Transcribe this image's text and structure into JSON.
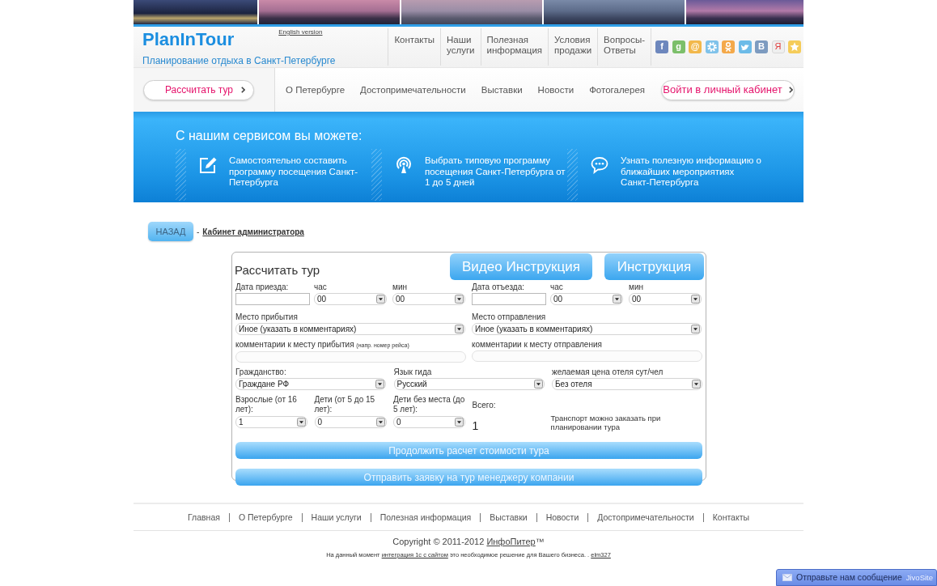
{
  "header": {
    "logo": "PlanInTour",
    "language_link": "English version",
    "tagline": "Планирование отдыха в Санкт-Петербурге",
    "top_nav": [
      "Контакты",
      "Наши услуги",
      "Полезная информация",
      "Условия продажи",
      "Вопросы-Ответы"
    ],
    "share_icons": [
      {
        "kind": "letter",
        "glyph": "f",
        "color": "#6d87bd"
      },
      {
        "kind": "letter",
        "glyph": "g",
        "color": "#7cbf6a"
      },
      {
        "kind": "letter",
        "glyph": "@",
        "color": "#f2b84b"
      },
      {
        "kind": "gear",
        "color": "#7fc2ea"
      },
      {
        "kind": "figure",
        "color": "#f4a94a"
      },
      {
        "kind": "bird",
        "color": "#6cbbe8"
      },
      {
        "kind": "letter",
        "glyph": "В",
        "color": "#7d9bc0"
      },
      {
        "kind": "red_letter",
        "glyph": "Я",
        "color": "#efefef"
      },
      {
        "kind": "star",
        "color": "#f5cc5a"
      }
    ]
  },
  "sub_nav": {
    "calc_button": "Рассчитать тур",
    "links": [
      "О Петербурге",
      "Достопримечательности",
      "Выставки",
      "Новости",
      "Фотогалерея"
    ],
    "login_button": "Войти в личный кабинет"
  },
  "banner": {
    "title": "С нашим сервисом вы можете:",
    "features": [
      {
        "kind": "edit",
        "text": "Самостоятельно составить программу посещения Санкт-Петербурга"
      },
      {
        "kind": "antenna",
        "text": "Выбрать типовую программу посещения Санкт-Петербурга от 1 до 5 дней"
      },
      {
        "kind": "chat",
        "text": "Узнать полезную информацию о ближайших мероприятиях Санкт-Петербурга"
      }
    ]
  },
  "breadcrumb": {
    "back_button": "НАЗАД",
    "separator": "-",
    "current": "Кабинет администратора"
  },
  "form": {
    "title": "Рассчитать тур",
    "buttons": [
      "Видео Инструкция",
      "Инструкция"
    ],
    "arrival": {
      "date_label": "Дата приезда:",
      "hour_label": "час",
      "hour_value": "00",
      "minute_label": "мин",
      "minute_value": "00"
    },
    "departure": {
      "date_label": "Дата отъезда:",
      "hour_label": "час",
      "hour_value": "00",
      "minute_label": "мин",
      "minute_value": "00"
    },
    "arrival_place": {
      "label": "Место прибытия",
      "value": "Иное (указать в комментариях)",
      "comment_label": "комментарии к месту прибытия",
      "comment_hint": "(напр. номер рейса)"
    },
    "departure_place": {
      "label": "Место отправления",
      "value": "Иное (указать в комментариях)",
      "comment_label": "комментарии к месту отправления"
    },
    "options": [
      {
        "label": "Гражданство:",
        "value": "Граждане РФ"
      },
      {
        "label": "Язык гида",
        "value": "Русский"
      },
      {
        "label": "желаемая цена отеля сут/чел",
        "value": "Без отеля"
      }
    ],
    "travellers": [
      {
        "label": "Взрослые (от 16 лет):",
        "value": "1"
      },
      {
        "label": "Дети (от 5 до 15 лет):",
        "value": "0"
      },
      {
        "label": "Дети без места (до 5 лет):",
        "value": "0"
      }
    ],
    "total": {
      "label": "Всего:",
      "value": "1"
    },
    "transport_note": "Транспорт можно заказать при планировании тура",
    "actions": [
      "Продолжить расчет стоимости тура",
      "Отправить заявку на тур менеджеру компании"
    ]
  },
  "footer": {
    "links": [
      "Главная",
      "О Петербурге",
      "Наши услуги",
      "Полезная информация",
      "Выставки",
      "Новости",
      "Достопримечательности",
      "Контакты"
    ],
    "copyright": [
      {
        "kind": "text",
        "text": "Copyright © 2011-2012 "
      },
      {
        "kind": "link",
        "text": "ИнфоПитер"
      },
      {
        "kind": "text",
        "text": "™"
      }
    ],
    "notice": [
      {
        "kind": "text",
        "text": "На данный момент "
      },
      {
        "kind": "link",
        "text": "интеграция 1с с сайтом"
      },
      {
        "kind": "text",
        "text": " это необходимое решение для Вашего бизнеса. . "
      },
      {
        "kind": "link",
        "text": "elm327"
      }
    ]
  },
  "chat_widget": {
    "label": "Отправьте нам сообщение",
    "brand": "JivoSite"
  }
}
